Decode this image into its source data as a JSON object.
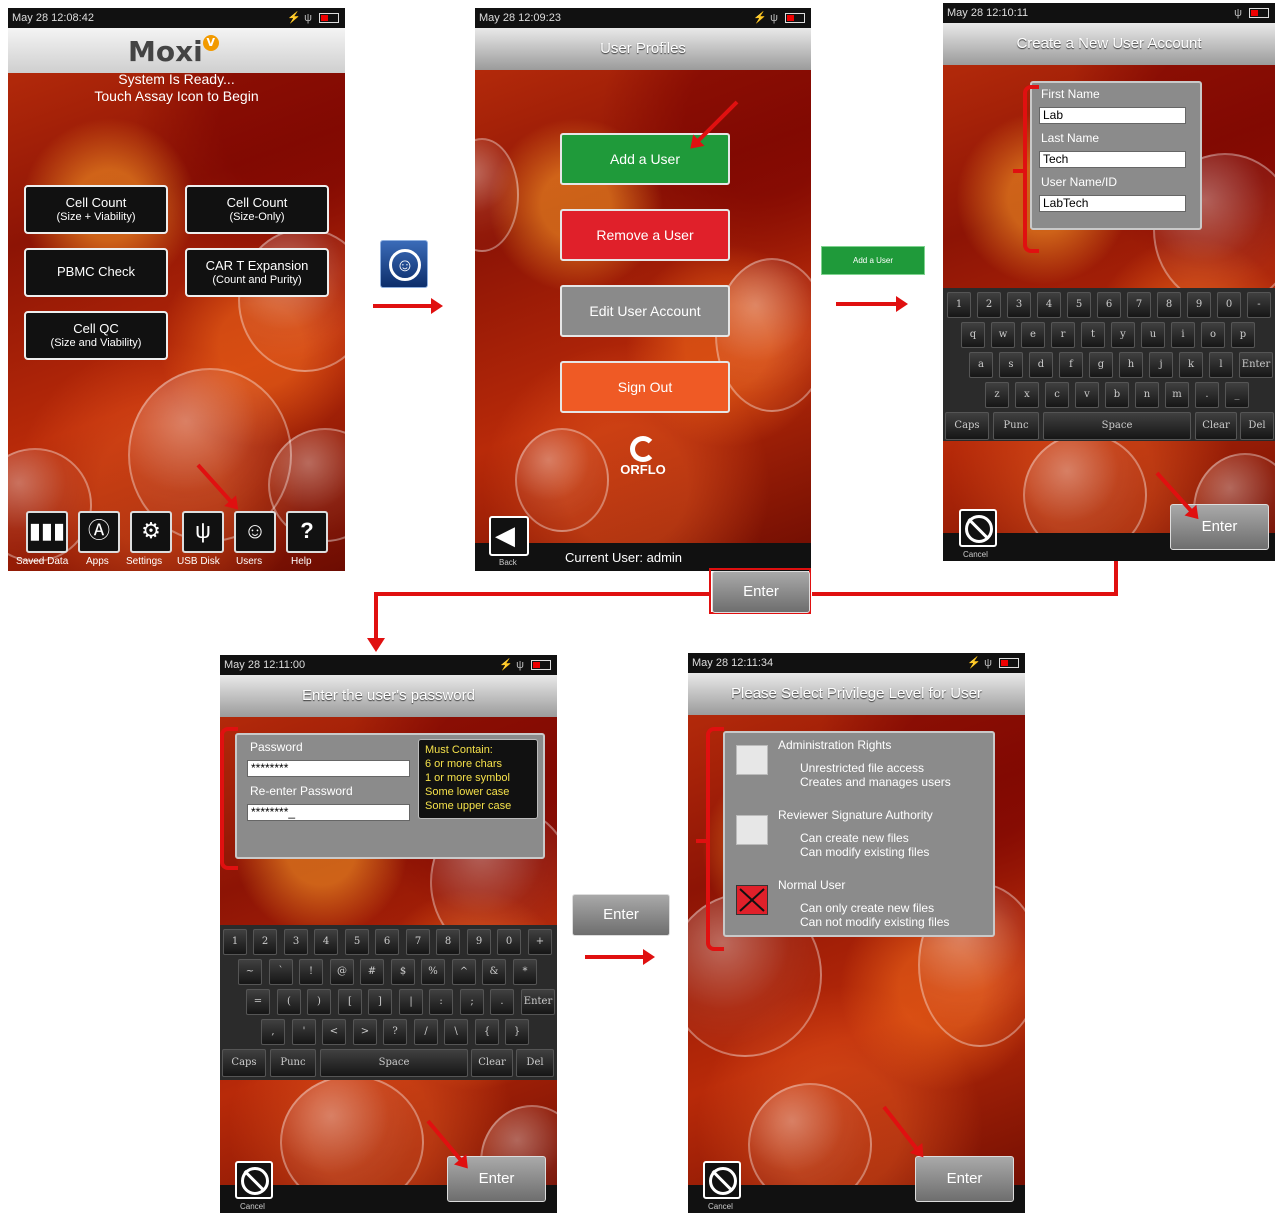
{
  "screen1": {
    "status_time": "May 28 12:08:42",
    "logo_text": "Moxi",
    "logo_badge": "V",
    "ready_line1": "System Is Ready...",
    "ready_line2": "Touch Assay Icon to Begin",
    "assays": [
      {
        "line1": "Cell Count",
        "line2": "(Size + Viability)"
      },
      {
        "line1": "Cell Count",
        "line2": "(Size-Only)"
      },
      {
        "line1": "PBMC Check",
        "line2": ""
      },
      {
        "line1": "CAR T Expansion",
        "line2": "(Count and Purity)"
      },
      {
        "line1": "Cell QC",
        "line2": "(Size and Viability)"
      }
    ],
    "bottom_bar": [
      {
        "label": "Saved Data",
        "icon": "bar-chart-icon"
      },
      {
        "label": "Apps",
        "icon": "apps-icon"
      },
      {
        "label": "Settings",
        "icon": "gear-icon"
      },
      {
        "label": "USB Disk",
        "icon": "usb-icon"
      },
      {
        "label": "Users",
        "icon": "users-icon"
      },
      {
        "label": "Help",
        "icon": "help-icon"
      }
    ]
  },
  "screen2": {
    "status_time": "May 28 12:09:23",
    "title": "User Profiles",
    "add_label": "Add a User",
    "remove_label": "Remove a User",
    "edit_label": "Edit User Account",
    "signout_label": "Sign Out",
    "brand": "ORFLO",
    "back_label": "Back",
    "current_user": "Current User: admin",
    "colors": {
      "add": "#1f9a3a",
      "remove": "#e0202a",
      "edit": "#8a8a8a",
      "signout": "#ef5a25"
    }
  },
  "mini_add_label": "Add a User",
  "screen3": {
    "status_time": "May 28 12:10:11",
    "title": "Create a New User Account",
    "first_name_label": "First Name",
    "first_name_value": "Lab",
    "last_name_label": "Last Name",
    "last_name_value": "Tech",
    "userid_label": "User Name/ID",
    "userid_value": "LabTech",
    "keys_row1": [
      "1",
      "2",
      "3",
      "4",
      "5",
      "6",
      "7",
      "8",
      "9",
      "0",
      "-"
    ],
    "keys_row2": [
      "q",
      "w",
      "e",
      "r",
      "t",
      "y",
      "u",
      "i",
      "o",
      "p"
    ],
    "keys_row3": [
      "a",
      "s",
      "d",
      "f",
      "g",
      "h",
      "j",
      "k",
      "l",
      "Enter"
    ],
    "keys_row4": [
      "z",
      "x",
      "c",
      "v",
      "b",
      "n",
      "m",
      ".",
      "_"
    ],
    "keys_row5": [
      "Caps",
      "Punc",
      "Space",
      "Clear",
      "Del"
    ],
    "cancel_label": "Cancel",
    "enter_label": "Enter"
  },
  "connector_enter_label": "Enter",
  "screen4": {
    "status_time": "May 28 12:11:00",
    "title": "Enter the user's password",
    "password_label": "Password",
    "password_value": "********",
    "reenter_label": "Re-enter Password",
    "reenter_value": "********_",
    "rules": [
      "Must Contain:",
      "6 or more chars",
      "1 or more symbol",
      "Some lower case",
      "Some upper case"
    ],
    "keys_row1": [
      "1",
      "2",
      "3",
      "4",
      "5",
      "6",
      "7",
      "8",
      "9",
      "0",
      "+"
    ],
    "keys_row2": [
      "~",
      "`",
      "!",
      "@",
      "#",
      "$",
      "%",
      "^",
      "&",
      "*"
    ],
    "keys_row3": [
      "=",
      "(",
      ")",
      "[",
      "]",
      "|",
      ":",
      ";",
      ".",
      "Enter"
    ],
    "keys_row4": [
      ",",
      "'",
      "<",
      ">",
      "?",
      "/",
      "\\",
      "{",
      "}"
    ],
    "keys_row5": [
      "Caps",
      "Punc",
      "Space",
      "Clear",
      "Del"
    ],
    "cancel_label": "Cancel",
    "enter_label": "Enter"
  },
  "middle_enter_label": "Enter",
  "screen5": {
    "status_time": "May 28 12:11:34",
    "title": "Please Select Privilege Level for User",
    "admin_title": "Administration Rights",
    "admin_desc1": "Unrestricted file access",
    "admin_desc2": "Creates and manages users",
    "reviewer_title": "Reviewer Signature Authority",
    "reviewer_desc1": "Can create new files",
    "reviewer_desc2": "Can modify existing files",
    "normal_title": "Normal User",
    "normal_desc1": "Can only create new files",
    "normal_desc2": "Can not modify existing files",
    "selected": "Normal User",
    "cancel_label": "Cancel",
    "enter_label": "Enter"
  }
}
